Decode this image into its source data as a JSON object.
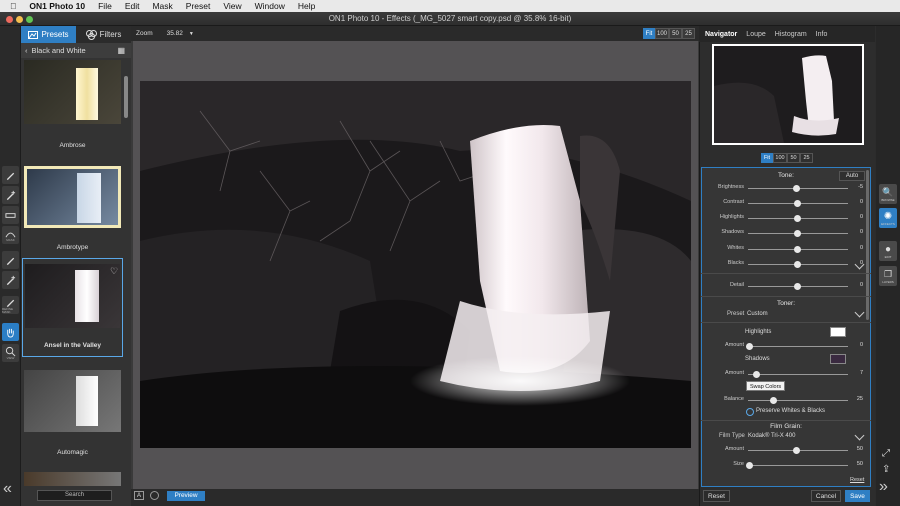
{
  "menubar": {
    "app": "ON1 Photo 10",
    "items": [
      "File",
      "Edit",
      "Mask",
      "Preset",
      "View",
      "Window",
      "Help"
    ]
  },
  "window_title": "ON1 Photo 10 - Effects (_MG_5027 smart copy.psd @ 35.8% 16-bit)",
  "left_tools": [
    {
      "icon": "brush-icon",
      "label": ""
    },
    {
      "icon": "brush-plus-icon",
      "label": ""
    },
    {
      "icon": "gradient-icon",
      "label": ""
    },
    {
      "icon": "mask-icon",
      "label": "MASK"
    },
    {
      "icon": "refine-brush-icon",
      "label": ""
    },
    {
      "icon": "refine-brush-plus-icon",
      "label": ""
    },
    {
      "icon": "refine-mask-icon",
      "label": "REFINE MASK"
    },
    {
      "icon": "hand-icon",
      "label": ""
    },
    {
      "icon": "zoom-icon",
      "label": "VIEW"
    }
  ],
  "panel_tabs": {
    "presets": "Presets",
    "filters": "Filters"
  },
  "breadcrumb": "Black and White",
  "presets": [
    {
      "name": "Ambrose",
      "selected": false,
      "tint": "#e8d8a0"
    },
    {
      "name": "Ambrotype",
      "selected": false,
      "tint": "#9ab0c8"
    },
    {
      "name": "Ansel in the Valley",
      "selected": true,
      "tint": "#dcdcdc"
    },
    {
      "name": "Automagic",
      "selected": false,
      "tint": "#d0d0d0"
    }
  ],
  "left_search": "Search",
  "zoom": {
    "label": "Zoom",
    "value": "35.82",
    "buttons": [
      "Fit",
      "100",
      "50",
      "25"
    ],
    "active": "Fit"
  },
  "preview_label": "Preview",
  "nav_tabs": [
    {
      "label": "Navigator",
      "active": true
    },
    {
      "label": "Loupe",
      "active": false
    },
    {
      "label": "Histogram",
      "active": false
    },
    {
      "label": "Info",
      "active": false
    }
  ],
  "nav_zoom": [
    "Fit",
    "100",
    "50",
    "25"
  ],
  "tone": {
    "title": "Tone:",
    "auto": "Auto",
    "sliders": [
      {
        "label": "Brightness",
        "value": "-5",
        "pos": 0.47
      },
      {
        "label": "Contrast",
        "value": "0",
        "pos": 0.5
      },
      {
        "label": "Highlights",
        "value": "0",
        "pos": 0.5
      },
      {
        "label": "Shadows",
        "value": "0",
        "pos": 0.5
      },
      {
        "label": "Whites",
        "value": "0",
        "pos": 0.5
      },
      {
        "label": "Blacks",
        "value": "0",
        "pos": 0.5
      }
    ],
    "detail": {
      "label": "Detail",
      "value": "0",
      "pos": 0.5
    }
  },
  "toner": {
    "title": "Toner:",
    "preset_label": "Preset",
    "preset_value": "Custom",
    "highlights_label": "Highlights",
    "highlights_color": "#ffffff",
    "highlights_amount": {
      "label": "Amount",
      "value": "0",
      "pos": 0.0
    },
    "shadows_label": "Shadows",
    "shadows_color": "#3a2a40",
    "shadows_amount": {
      "label": "Amount",
      "value": "7",
      "pos": 0.07
    },
    "tooltip": "Swap Colors",
    "balance": {
      "label": "Balance",
      "value": "25",
      "pos": 0.25
    },
    "preserve": "Preserve Whites & Blacks"
  },
  "grain": {
    "title": "Film Grain:",
    "type_label": "Film Type",
    "type_value": "Kodak® Tri-X 400",
    "amount": {
      "label": "Amount",
      "value": "50",
      "pos": 0.5
    },
    "size": {
      "label": "Size",
      "value": "50",
      "pos": 0.0
    },
    "reset": "Reset"
  },
  "right_tools": [
    {
      "icon": "browse-icon",
      "label": "BROWSE"
    },
    {
      "icon": "effects-icon",
      "label": "EFFECTS"
    },
    {
      "icon": "portrait-icon",
      "label": "EDIT"
    },
    {
      "icon": "layers-icon",
      "label": "LAYERS"
    }
  ],
  "bottom": {
    "reset": "Reset",
    "cancel": "Cancel",
    "save": "Save"
  },
  "colors": {
    "accent": "#2f7fc4"
  }
}
